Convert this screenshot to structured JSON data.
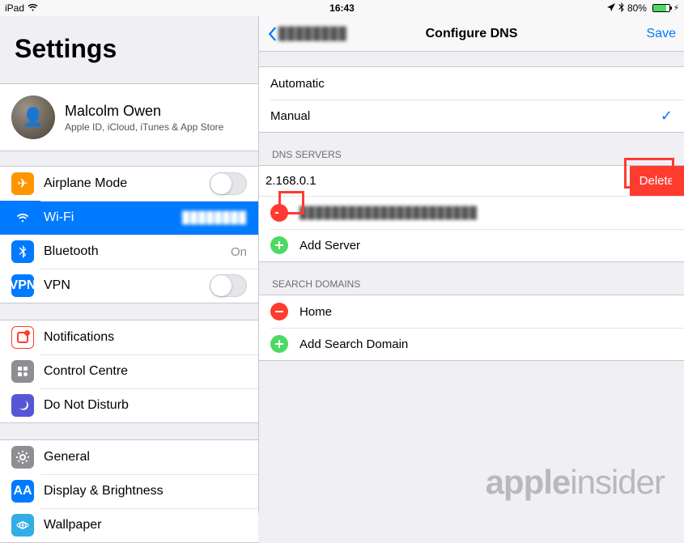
{
  "statusbar": {
    "device": "iPad",
    "time": "16:43",
    "battery_pct": "80%"
  },
  "sidebar": {
    "title": "Settings",
    "profile": {
      "name": "Malcolm Owen",
      "subtitle": "Apple ID, iCloud, iTunes & App Store"
    },
    "group1": [
      {
        "label": "Airplane Mode",
        "icon": "airplane",
        "value": "",
        "toggle": true
      },
      {
        "label": "Wi-Fi",
        "icon": "wifi",
        "value": "████████",
        "selected": true
      },
      {
        "label": "Bluetooth",
        "icon": "bluetooth",
        "value": "On"
      },
      {
        "label": "VPN",
        "icon": "vpn",
        "value": "",
        "toggle": true
      }
    ],
    "group2": [
      {
        "label": "Notifications",
        "icon": "notifications"
      },
      {
        "label": "Control Centre",
        "icon": "controlcentre"
      },
      {
        "label": "Do Not Disturb",
        "icon": "dnd"
      }
    ],
    "group3": [
      {
        "label": "General",
        "icon": "general"
      },
      {
        "label": "Display & Brightness",
        "icon": "display"
      },
      {
        "label": "Wallpaper",
        "icon": "wallpaper"
      }
    ]
  },
  "detail": {
    "back_label": "████████",
    "title": "Configure DNS",
    "save_label": "Save",
    "mode": {
      "automatic": "Automatic",
      "manual": "Manual"
    },
    "sections": {
      "dns_servers": "DNS SERVERS",
      "search_domains": "SEARCH DOMAINS"
    },
    "dns": {
      "swiped_entry": "2.168.0.1",
      "delete_label": "Delete",
      "entry2": "██████████████████████",
      "add_server": "Add Server"
    },
    "search": {
      "entry1": "Home",
      "add_domain": "Add Search Domain"
    }
  },
  "watermark": {
    "a": "apple",
    "b": "insider"
  }
}
